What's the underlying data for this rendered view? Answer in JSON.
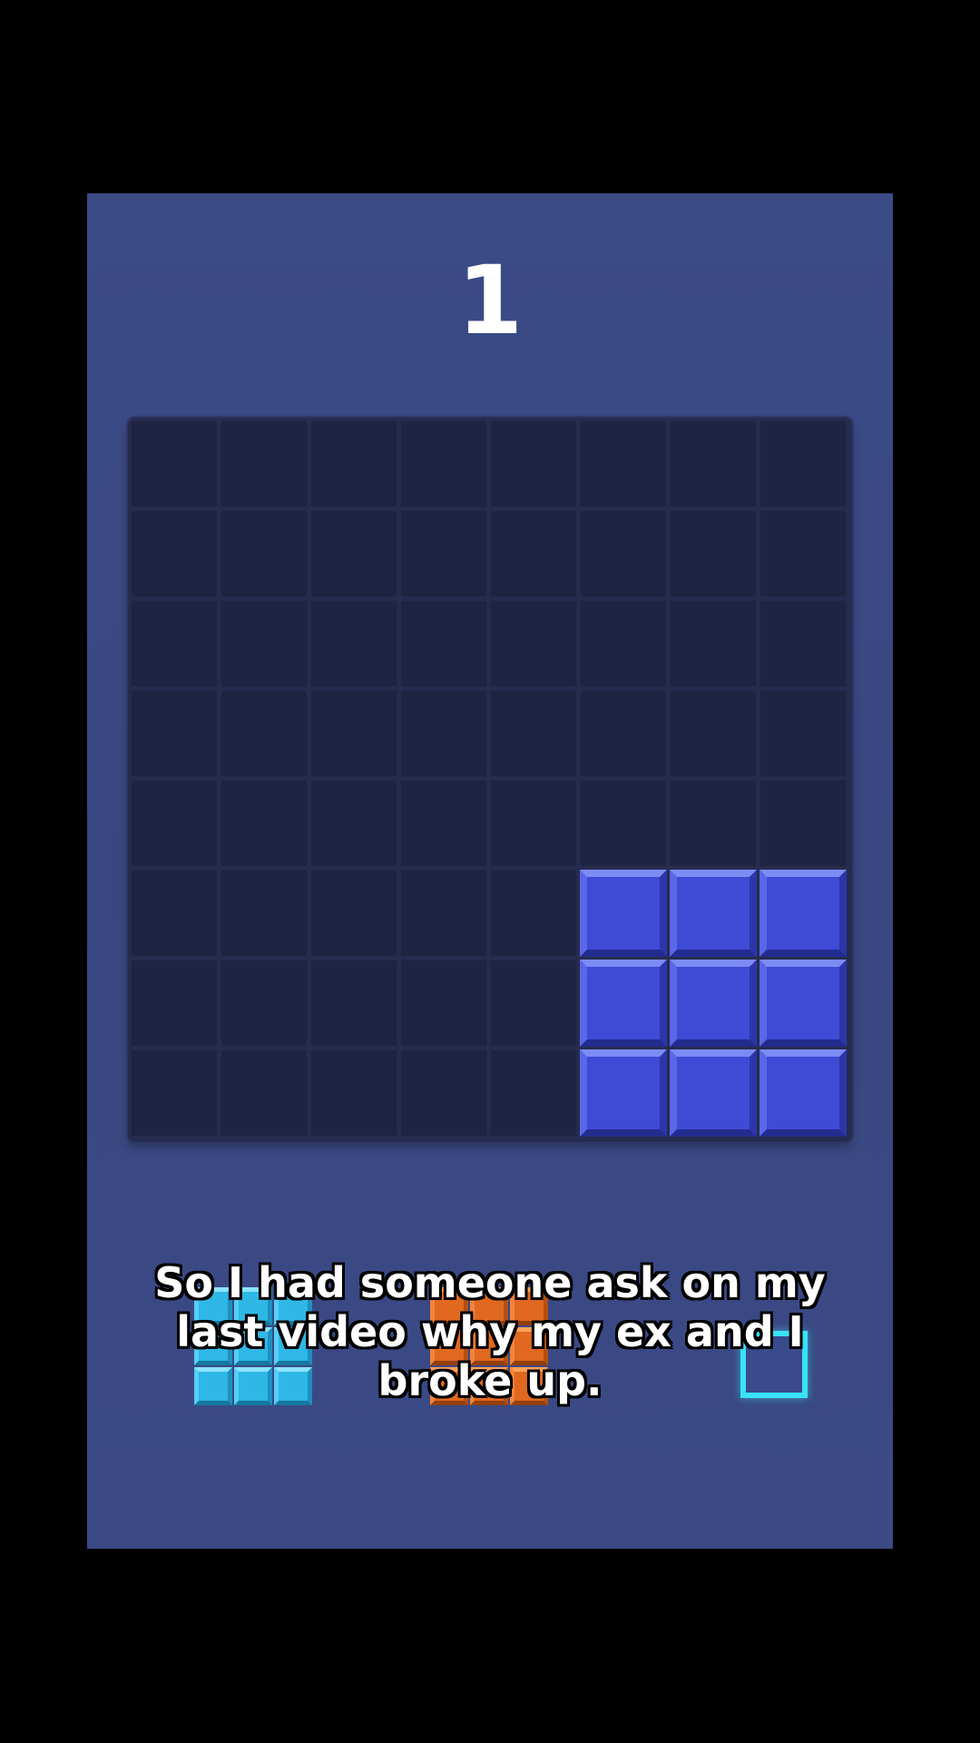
{
  "score": "1",
  "board": {
    "rows": 8,
    "cols": 8,
    "filled": [
      [
        0,
        0,
        0,
        0,
        0,
        0,
        0,
        0
      ],
      [
        0,
        0,
        0,
        0,
        0,
        0,
        0,
        0
      ],
      [
        0,
        0,
        0,
        0,
        0,
        0,
        0,
        0
      ],
      [
        0,
        0,
        0,
        0,
        0,
        0,
        0,
        0
      ],
      [
        0,
        0,
        0,
        0,
        0,
        0,
        0,
        0
      ],
      [
        0,
        0,
        0,
        0,
        0,
        1,
        1,
        1
      ],
      [
        0,
        0,
        0,
        0,
        0,
        1,
        1,
        1
      ],
      [
        0,
        0,
        0,
        0,
        0,
        1,
        1,
        1
      ]
    ],
    "colors": {
      "filled": "#3f4bd6",
      "empty": "#1f2442"
    }
  },
  "tray": {
    "pieces": [
      {
        "name": "cyan-piece",
        "color": "#2fb7e6"
      },
      {
        "name": "orange-piece",
        "color": "#e0691f"
      },
      {
        "name": "next-slot",
        "color": "#38e3f5"
      }
    ]
  },
  "caption": {
    "line1": "So I had someone ask on my",
    "line2": "last video why my ex and I",
    "line3": "broke up."
  }
}
